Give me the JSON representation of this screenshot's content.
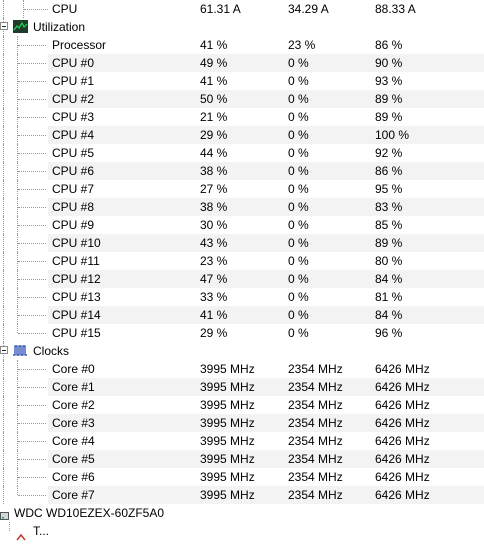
{
  "top_row": {
    "label": "CPU",
    "value": "61.31 A",
    "min": "34.29 A",
    "max": "88.33 A"
  },
  "utilization": {
    "label": "Utilization",
    "rows": [
      {
        "label": "Processor",
        "value": "41 %",
        "min": "23 %",
        "max": "86 %"
      },
      {
        "label": "CPU #0",
        "value": "49 %",
        "min": "0 %",
        "max": "90 %"
      },
      {
        "label": "CPU #1",
        "value": "41 %",
        "min": "0 %",
        "max": "93 %"
      },
      {
        "label": "CPU #2",
        "value": "50 %",
        "min": "0 %",
        "max": "89 %"
      },
      {
        "label": "CPU #3",
        "value": "21 %",
        "min": "0 %",
        "max": "89 %"
      },
      {
        "label": "CPU #4",
        "value": "29 %",
        "min": "0 %",
        "max": "100 %"
      },
      {
        "label": "CPU #5",
        "value": "44 %",
        "min": "0 %",
        "max": "92 %"
      },
      {
        "label": "CPU #6",
        "value": "38 %",
        "min": "0 %",
        "max": "86 %"
      },
      {
        "label": "CPU #7",
        "value": "27 %",
        "min": "0 %",
        "max": "95 %"
      },
      {
        "label": "CPU #8",
        "value": "38 %",
        "min": "0 %",
        "max": "83 %"
      },
      {
        "label": "CPU #9",
        "value": "30 %",
        "min": "0 %",
        "max": "85 %"
      },
      {
        "label": "CPU #10",
        "value": "43 %",
        "min": "0 %",
        "max": "89 %"
      },
      {
        "label": "CPU #11",
        "value": "23 %",
        "min": "0 %",
        "max": "80 %"
      },
      {
        "label": "CPU #12",
        "value": "47 %",
        "min": "0 %",
        "max": "84 %"
      },
      {
        "label": "CPU #13",
        "value": "33 %",
        "min": "0 %",
        "max": "81 %"
      },
      {
        "label": "CPU #14",
        "value": "41 %",
        "min": "0 %",
        "max": "84 %"
      },
      {
        "label": "CPU #15",
        "value": "29 %",
        "min": "0 %",
        "max": "96 %"
      }
    ]
  },
  "clocks": {
    "label": "Clocks",
    "rows": [
      {
        "label": "Core #0",
        "value": "3995 MHz",
        "min": "2354 MHz",
        "max": "6426 MHz"
      },
      {
        "label": "Core #1",
        "value": "3995 MHz",
        "min": "2354 MHz",
        "max": "6426 MHz"
      },
      {
        "label": "Core #2",
        "value": "3995 MHz",
        "min": "2354 MHz",
        "max": "6426 MHz"
      },
      {
        "label": "Core #3",
        "value": "3995 MHz",
        "min": "2354 MHz",
        "max": "6426 MHz"
      },
      {
        "label": "Core #4",
        "value": "3995 MHz",
        "min": "2354 MHz",
        "max": "6426 MHz"
      },
      {
        "label": "Core #5",
        "value": "3995 MHz",
        "min": "2354 MHz",
        "max": "6426 MHz"
      },
      {
        "label": "Core #6",
        "value": "3995 MHz",
        "min": "2354 MHz",
        "max": "6426 MHz"
      },
      {
        "label": "Core #7",
        "value": "3995 MHz",
        "min": "2354 MHz",
        "max": "6426 MHz"
      }
    ]
  },
  "disk": {
    "label": "WDC WD10EZEX-60ZF5A0"
  },
  "next_group": {
    "label": "T..."
  },
  "icons": {
    "utilization": "utilization-graph-icon",
    "clocks": "clock-pulse-icon",
    "disk": "hard-disk-icon"
  },
  "colors": {
    "alt_row": "#f3f3f3",
    "tree_line": "#9a9a9a",
    "graph_green": "#22aa44"
  }
}
